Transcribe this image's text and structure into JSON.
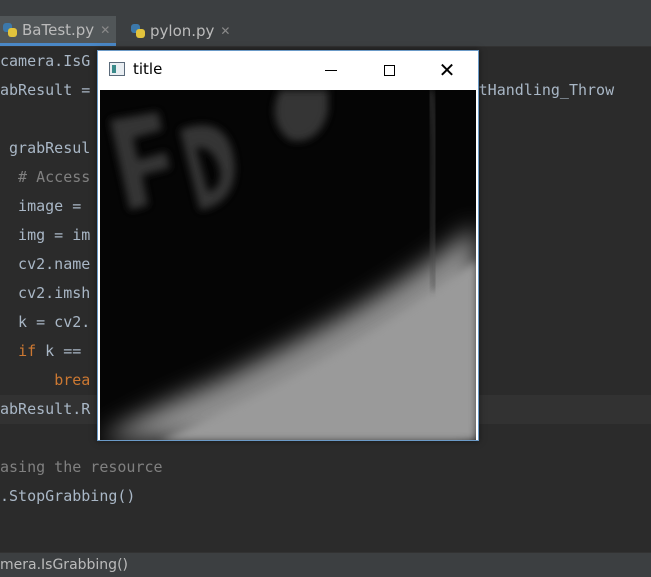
{
  "tabs": [
    {
      "label": "BaTest.py",
      "active": true
    },
    {
      "label": "pylon.py",
      "active": false
    }
  ],
  "code_lines": [
    {
      "indent": "",
      "segments": [
        {
          "t": "camera.IsG",
          "c": ""
        },
        {
          "t": "                                        ",
          "c": ""
        }
      ]
    },
    {
      "indent": "",
      "segments": [
        {
          "t": "abResult =",
          "c": ""
        },
        {
          "t": "                                        eoutHandling_Throw",
          "c": ""
        }
      ]
    },
    {
      "indent": "",
      "segments": [
        {
          "t": "",
          "c": ""
        }
      ]
    },
    {
      "indent": "",
      "segments": [
        {
          "t": " grabResul",
          "c": ""
        }
      ]
    },
    {
      "indent": "",
      "segments": [
        {
          "t": "  # Access",
          "c": "cm"
        }
      ]
    },
    {
      "indent": "",
      "segments": [
        {
          "t": "  image = ",
          "c": ""
        }
      ]
    },
    {
      "indent": "",
      "segments": [
        {
          "t": "  img = im",
          "c": ""
        }
      ]
    },
    {
      "indent": "",
      "segments": [
        {
          "t": "  cv2.name",
          "c": ""
        }
      ]
    },
    {
      "indent": "",
      "segments": [
        {
          "t": "  cv2.imsh",
          "c": ""
        }
      ]
    },
    {
      "indent": "",
      "segments": [
        {
          "t": "  k = cv2.",
          "c": ""
        }
      ]
    },
    {
      "indent": "",
      "segments": [
        {
          "t": "  ",
          "c": ""
        },
        {
          "t": "if",
          "c": "kw"
        },
        {
          "t": " k ==",
          "c": ""
        }
      ]
    },
    {
      "indent": "",
      "segments": [
        {
          "t": "      ",
          "c": ""
        },
        {
          "t": "brea",
          "c": "kw"
        }
      ]
    },
    {
      "indent": "",
      "segments": [
        {
          "t": "abResult.R",
          "c": ""
        }
      ]
    },
    {
      "indent": "",
      "segments": [
        {
          "t": "",
          "c": ""
        }
      ]
    },
    {
      "indent": "",
      "segments": [
        {
          "t": "asing the resource",
          "c": "cm"
        }
      ]
    },
    {
      "indent": "",
      "segments": [
        {
          "t": ".StopGrabbing()",
          "c": ""
        }
      ]
    }
  ],
  "highlighted_line": 12,
  "statusbar": {
    "breadcrumb": "mera.IsGrabbing()"
  },
  "cv_window": {
    "title": "title",
    "min_label": "",
    "close_glyph": "✕"
  }
}
